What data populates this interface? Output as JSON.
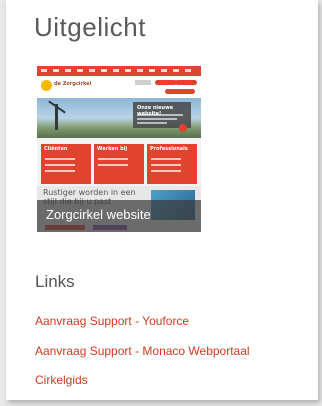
{
  "featured": {
    "heading": "Uitgelicht",
    "thumbnail": {
      "caption": "Zorgcirkel website",
      "preview": {
        "logo": "de Zorgcirkel",
        "hero_title": "Onze nieuwe website!",
        "tiles": [
          "Cliënten",
          "Werken bij",
          "Professionals"
        ],
        "promo": "Rustiger worden in een stijl die bij u past"
      }
    }
  },
  "links": {
    "heading": "Links",
    "items": [
      {
        "label": "Aanvraag Support - Youforce"
      },
      {
        "label": "Aanvraag Support - Monaco Webportaal"
      },
      {
        "label": "Cirkelgids"
      }
    ]
  },
  "colors": {
    "link": "#d13b22",
    "brand": "#e0442f"
  }
}
